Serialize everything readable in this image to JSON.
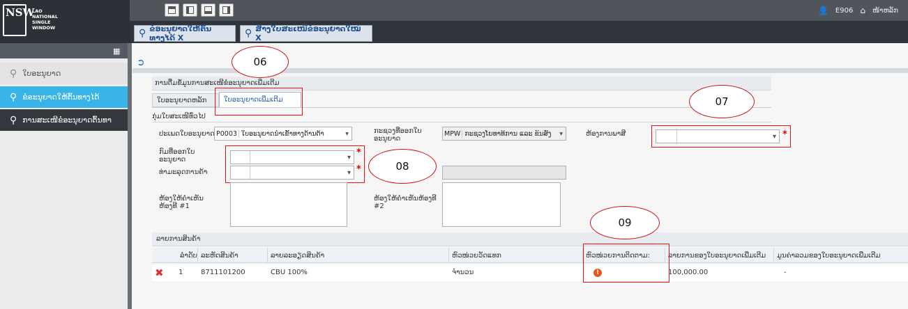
{
  "header": {
    "logo_mark": "NSW",
    "logo_lines": [
      "LAO",
      "NATIONAL",
      "SINGLE",
      "WINDOW"
    ],
    "user": "E906",
    "home_label": "ໜ້າຫລັກ"
  },
  "tabs": [
    {
      "label": "ຂໍອະນຸຍາດໃຫ້ຕົ້ນທາງໄດ້ X"
    },
    {
      "label": "ສ້າງໃບສະເໜີຂໍອະນຸຍາດໃໝ່ X"
    }
  ],
  "sidebar": {
    "items": [
      {
        "label": "ໃບອະນຸຍາດ",
        "active": false
      },
      {
        "label": "ຂໍອະນຸຍາດໃຫ້ຕົ້ນທາງໄດ້",
        "active": true
      },
      {
        "label": "ການສະເໜີຂໍອະນຸຍາດຕົ້ນທາ",
        "active": false
      }
    ]
  },
  "form": {
    "section_title": "ການຕື່ມຂໍ້ມູນການສະເໜີຂໍອະນຸຍາດເພີ່ມເຕີມ",
    "subtabs": [
      "ໃບອະນຸຍາດຫລັກ",
      "ໃບອະນຸຍາດເພີ່ມເຕີມ"
    ],
    "general_section": "ກຸ່ມໃບສະເໜີທົ່ວໄປ",
    "fields": {
      "permit_type_label": "ປະເພດໃບອະນຸຍາດ",
      "permit_type_code": "P0003",
      "permit_type_value": "ໃບອະນຸຍາດນຳເຂົ້າທາງດ້ານຕ້າ",
      "ministry_label": "ກະຊວງທີ່ອອກໃບອະນຸຍາດ",
      "ministry_code": "MPW",
      "ministry_value": "ກະຊວງໂຍທາທິການ ແລະ ຂົນສົ່ງ",
      "customs_label": "ຫ້ອງການພາສີ",
      "issue_dept_label": "ກົມທີ່ອອກໃບອະນຸຍາດ",
      "trade_type_label": "ທ່າມະລຸດການຄ້າ",
      "remark1_label": "ຫ້ອງໃຫ້ຄຳເຫັນຫ້ອງທີ #1",
      "remark2_label": "ຫ້ອງໃຫ້ຄຳເຫັນຫ້ອງທີ #2"
    }
  },
  "goods": {
    "title": "ລາຍການສິນຄ້າ",
    "columns": [
      "ລຳດັບ",
      "ລະຫັດສິນຄ້າ",
      "ລາຍລະອຽດສິນຄ້າ",
      "ຫົວໜ່ວຍວັດແທກ",
      "ຫົວໜ່ວຍການຕິດຕາມ:",
      "ລາຍການຂອງໃບອະນຸຍາດເພີ່ມເຕີມ",
      "ມູນຄ່າລວມຂອງໃບອະນຸຍາດເພີ່ມເຕີມ"
    ],
    "rows": [
      {
        "no": "1",
        "code": "8711101200",
        "desc": "CBU 100%",
        "unit": "ຈຳນວນ",
        "qty": "100,000.00",
        "value": "-"
      }
    ]
  },
  "annotations": [
    "06",
    "07",
    "08",
    "09"
  ]
}
